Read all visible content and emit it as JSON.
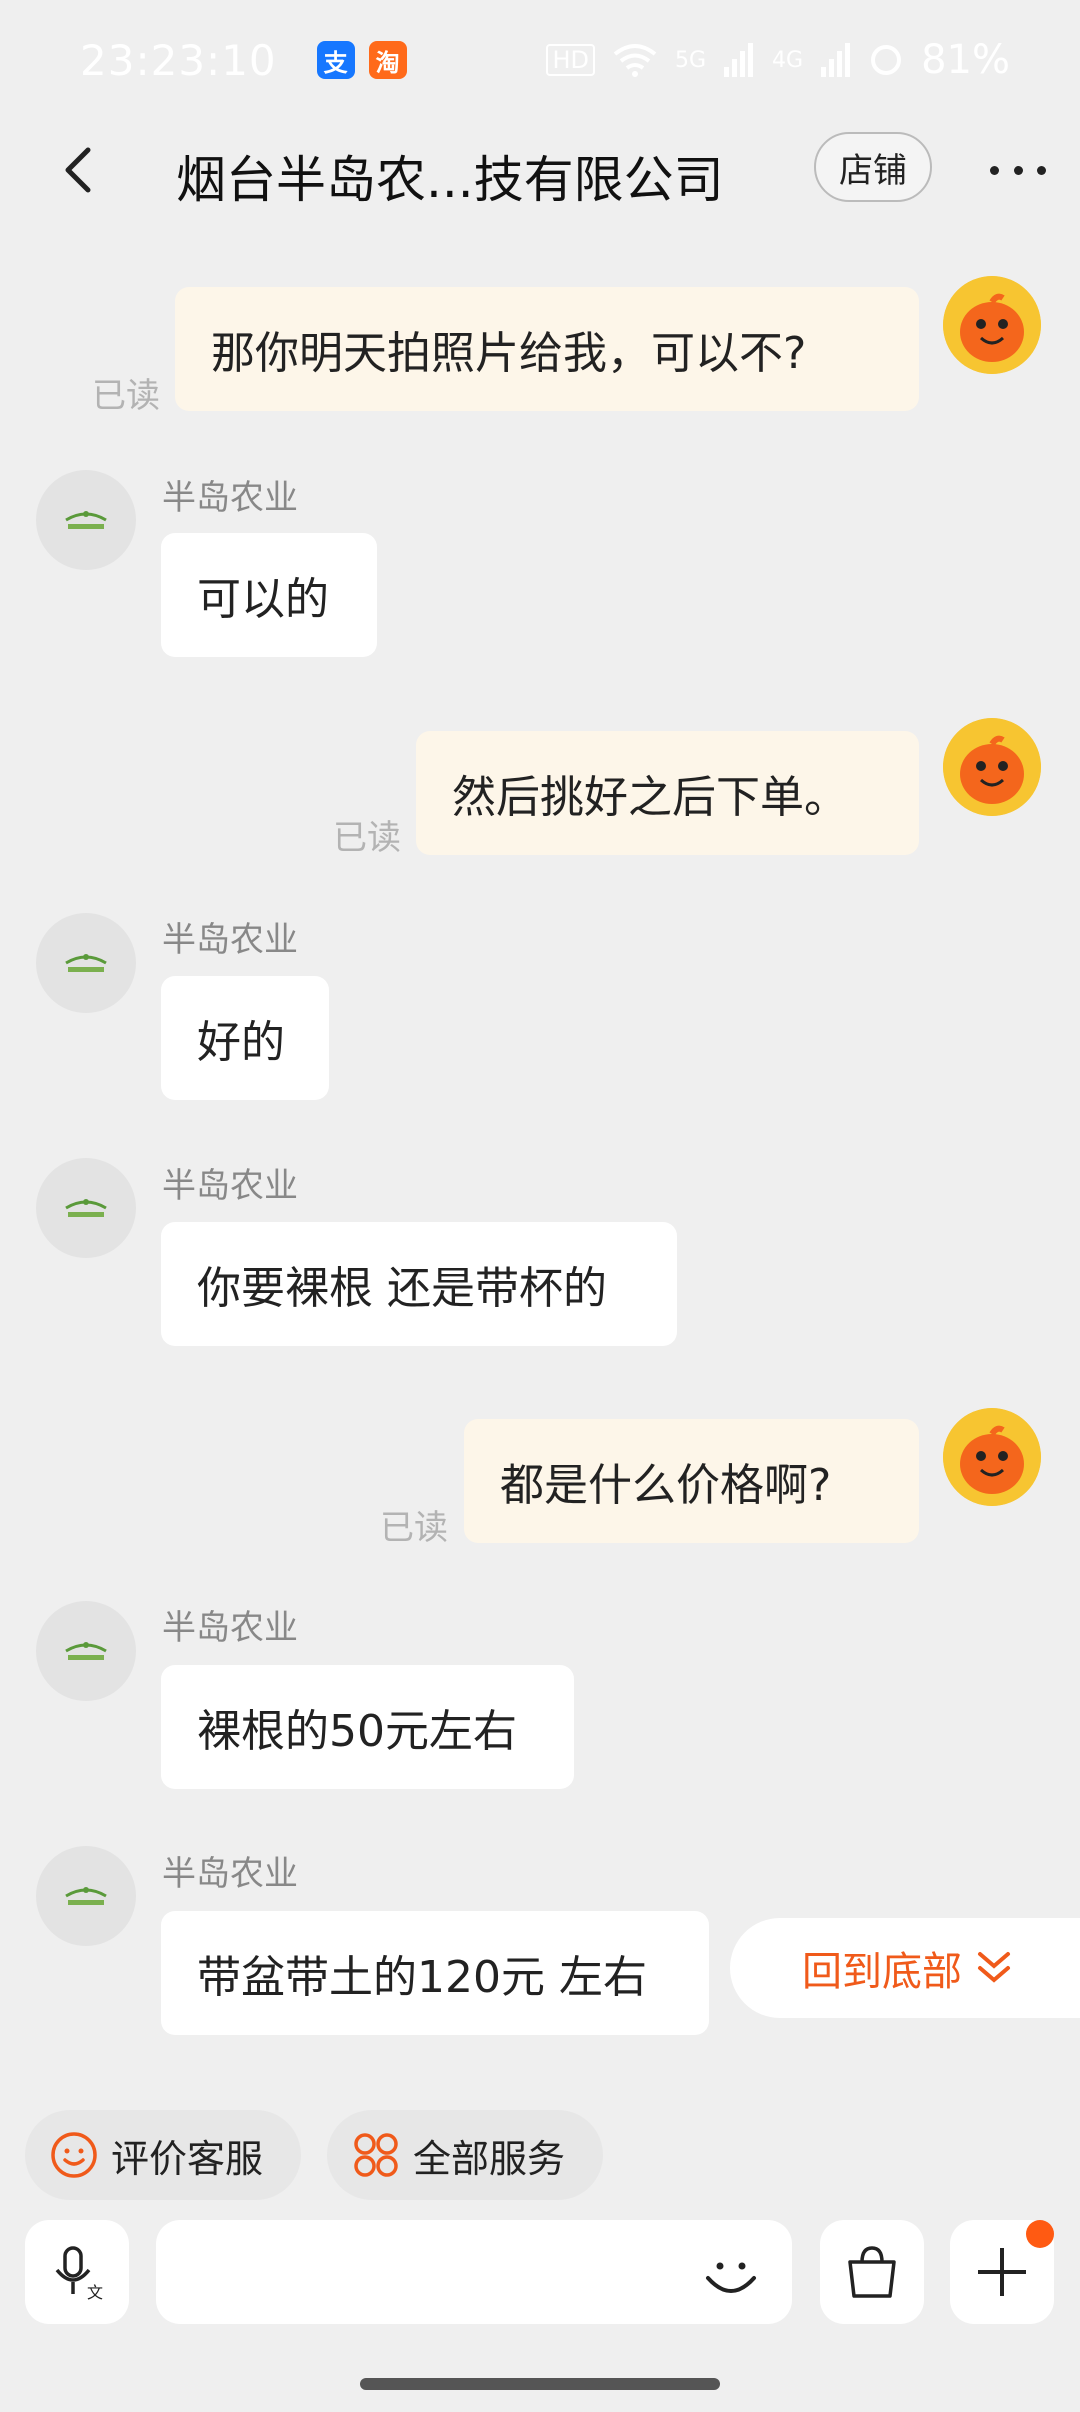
{
  "status_bar": {
    "time": "23:23:10",
    "alipay_badge": "支",
    "taobao_badge": "淘",
    "hd": "HD",
    "net1": "5G",
    "net2": "4G",
    "battery": "81%"
  },
  "header": {
    "title": "烟台半岛农...技有限公司",
    "store_label": "店铺"
  },
  "messages": [
    {
      "side": "me",
      "text": "那你明天拍照片给我，可以不?",
      "read": "已读"
    },
    {
      "side": "them",
      "sender": "半岛农业",
      "text": "可以的"
    },
    {
      "side": "me",
      "text": "然后挑好之后下单。",
      "read": "已读"
    },
    {
      "side": "them",
      "sender": "半岛农业",
      "text": "好的"
    },
    {
      "side": "them",
      "sender": "半岛农业",
      "text": "你要裸根 还是带杯的"
    },
    {
      "side": "me",
      "text": "都是什么价格啊?",
      "read": "已读"
    },
    {
      "side": "them",
      "sender": "半岛农业",
      "text": "裸根的50元左右"
    },
    {
      "side": "them",
      "sender": "半岛农业",
      "text": "带盆带土的120元 左右"
    }
  ],
  "back_to_bottom": "回到底部",
  "quick_services": [
    {
      "label": "评价客服",
      "icon": "smile-icon"
    },
    {
      "label": "全部服务",
      "icon": "grid-icon"
    }
  ],
  "input": {
    "placeholder": ""
  },
  "colors": {
    "accent": "#f05a1a",
    "my_bubble": "#fdf6e9",
    "their_bubble": "#ffffff",
    "background": "#efefef"
  }
}
